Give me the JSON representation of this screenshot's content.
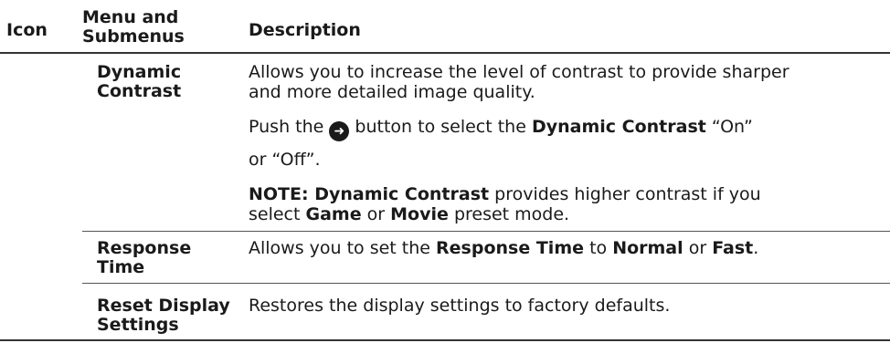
{
  "header": {
    "col_icon": "Icon",
    "col_menu": "Menu and Submenus",
    "col_menu_line1": "Menu and",
    "col_menu_line2": "Submenus",
    "col_description": "Description"
  },
  "rows": [
    {
      "name_line1": "Dynamic",
      "name_line2": "Contrast",
      "desc1_line1": "Allows you to increase the level of contrast to provide sharper",
      "desc1_line2": "and more detailed image quality.",
      "push_pre": "Push the",
      "push_mid": "button to select the",
      "push_bold": "Dynamic Contrast",
      "push_post": "“On”",
      "push_line2": "or “Off”.",
      "note_bold": "NOTE: Dynamic Contrast",
      "note_post": "provides higher contrast if you",
      "note_line2_pre": "select",
      "note_game": "Game",
      "note_or": "or",
      "note_movie": "Movie",
      "note_line2_post": "preset mode.",
      "arrow_icon": "right-arrow-icon"
    },
    {
      "name_line1": "Response",
      "name_line2": "Time",
      "desc_pre": "Allows you to set the",
      "desc_bold1": "Response Time",
      "desc_to": "to",
      "desc_bold2": "Normal",
      "desc_or": "or",
      "desc_bold3": "Fast",
      "desc_end": "."
    },
    {
      "name_line1": "Reset Display",
      "name_line2": "Settings",
      "desc": "Restores the display settings to factory defaults."
    }
  ]
}
